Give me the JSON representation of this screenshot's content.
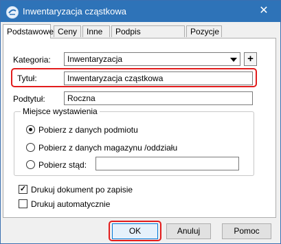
{
  "window": {
    "title": "Inwentaryzacja cząstkowa",
    "close_glyph": "✕"
  },
  "tabs": [
    {
      "label": "Podstawowe",
      "active": true
    },
    {
      "label": "Ceny",
      "active": false
    },
    {
      "label": "Inne",
      "active": false
    },
    {
      "label": "Podpis elektroniczny",
      "active": false
    },
    {
      "label": "Pozycje",
      "active": false
    }
  ],
  "form": {
    "kategoria_label": "Kategoria:",
    "kategoria_value": "Inwentaryzacja",
    "add_glyph": "+",
    "tytul_label": "Tytuł:",
    "tytul_value": "Inwentaryzacja cząstkowa",
    "podtytul_label": "Podtytuł:",
    "podtytul_value": "Roczna"
  },
  "group": {
    "title": "Miejsce wystawienia",
    "options": [
      {
        "label": "Pobierz z danych podmiotu",
        "selected": true
      },
      {
        "label": "Pobierz z danych magazynu /oddziału",
        "selected": false
      },
      {
        "label": "Pobierz stąd:",
        "selected": false
      }
    ],
    "custom_value": ""
  },
  "checkboxes": [
    {
      "label": "Drukuj dokument po zapisie",
      "checked": true,
      "mark": "✓"
    },
    {
      "label": "Drukuj automatycznie",
      "checked": false,
      "mark": ""
    }
  ],
  "buttons": {
    "ok": "OK",
    "cancel": "Anuluj",
    "help": "Pomoc"
  },
  "colors": {
    "titlebar": "#2e73b8",
    "highlight": "#e21b1b"
  },
  "icons": {
    "app": "app-logo-icon",
    "close": "close-icon",
    "dropdown": "chevron-down-icon"
  }
}
